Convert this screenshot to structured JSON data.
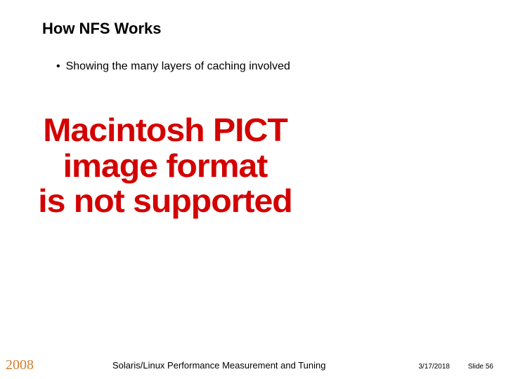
{
  "title": "How NFS Works",
  "bullet": {
    "dot": "•",
    "text": "Showing the many layers of caching involved"
  },
  "error": {
    "line1": "Macintosh PICT",
    "line2": "image format",
    "line3": "is not supported"
  },
  "footer": {
    "year": "2008",
    "center": "Solaris/Linux Performance Measurement and Tuning",
    "date": "3/17/2018",
    "slide": "Slide 56"
  }
}
